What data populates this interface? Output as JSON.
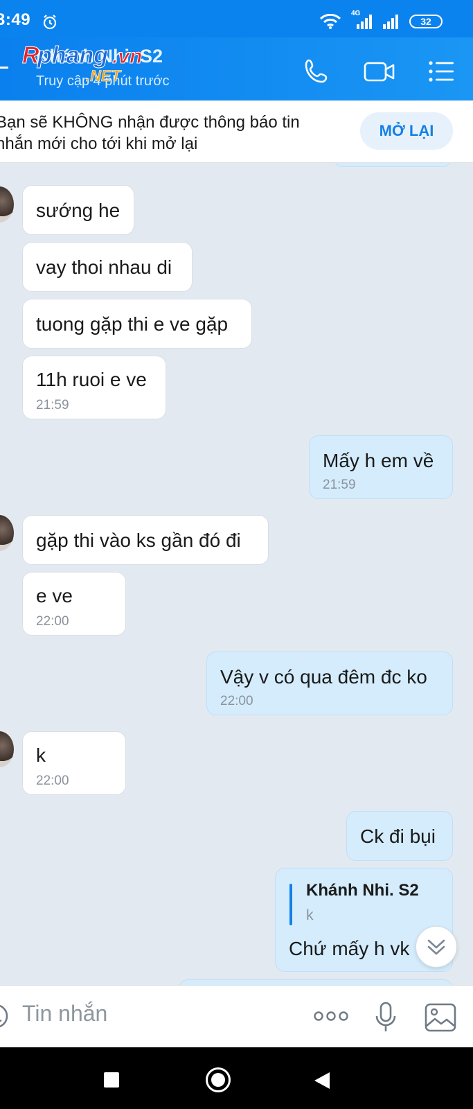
{
  "status_bar": {
    "time": "3:49",
    "network": "4G",
    "battery": "32",
    "icons": [
      "alarm-icon",
      "wifi-icon",
      "signal-icon",
      "signal-icon",
      "battery-icon"
    ]
  },
  "header": {
    "title": "Khánh Nhi. S2",
    "subtitle": "Truy cập 4 phút trước",
    "watermark": "Rphang.vn .NET",
    "icons": [
      "back-icon",
      "phone-icon",
      "video-call-icon",
      "menu-icon"
    ]
  },
  "notice": {
    "text": "Bạn sẽ KHÔNG nhận được thông báo tin nhắn mới cho tới khi mở lại",
    "button_label": "MỞ LẠI"
  },
  "messages": [
    {
      "from": "in",
      "text": "sướng he",
      "time": ""
    },
    {
      "from": "in",
      "text": "vay thoi nhau di",
      "time": ""
    },
    {
      "from": "in",
      "text": "tuong gặp thi e ve gặp",
      "time": ""
    },
    {
      "from": "in",
      "text": "11h ruoi e ve",
      "time": "21:59"
    },
    {
      "from": "out",
      "text": "Mấy h em về",
      "time": "21:59"
    },
    {
      "from": "in",
      "text": "gặp thi vào ks gần đó đi",
      "time": ""
    },
    {
      "from": "in",
      "text": "e ve",
      "time": "22:00"
    },
    {
      "from": "out",
      "text": "Vậy v có qua đêm đc ko",
      "time": "22:00"
    },
    {
      "from": "in",
      "text": "k",
      "time": "22:00"
    },
    {
      "from": "out",
      "text": "Ck đi bụi",
      "time": ""
    },
    {
      "from": "out",
      "quote_name": "Khánh Nhi. S2",
      "quote_text": "k",
      "text": "Chứ mấy h vk",
      "time": ""
    }
  ],
  "input": {
    "placeholder": "Tin nhắn",
    "icons": [
      "sticker-icon",
      "more-icon",
      "microphone-icon",
      "image-icon"
    ]
  },
  "nav": {
    "icons": [
      "recents-icon",
      "home-icon",
      "back-triangle-icon"
    ]
  },
  "colors": {
    "header": "#0b83ef",
    "chat_bg": "#e2e9f1",
    "outgoing_bubble": "#d4ecfc",
    "incoming_bubble": "#ffffff",
    "accent": "#1480e6"
  }
}
